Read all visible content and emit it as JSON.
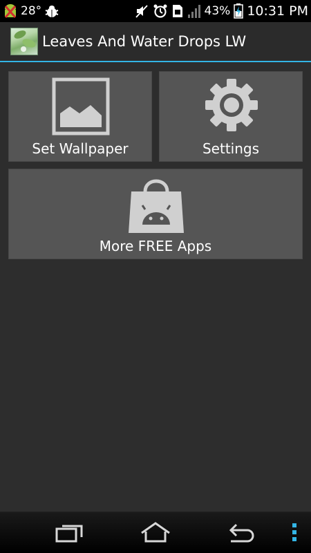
{
  "status_bar": {
    "temperature": "28°",
    "battery_percent": "43%",
    "time": "10:31 PM",
    "icons": [
      "android-debug-icon",
      "bug-icon",
      "mute-icon",
      "alarm-icon",
      "sim-icon",
      "signal-icon",
      "battery-charging-icon"
    ]
  },
  "action_bar": {
    "title": "Leaves And Water Drops LW",
    "accent_color": "#33b5e5"
  },
  "tiles": {
    "set_wallpaper": {
      "label": "Set Wallpaper",
      "icon": "image-icon"
    },
    "settings": {
      "label": "Settings",
      "icon": "gear-icon"
    },
    "more_apps": {
      "label": "More FREE Apps",
      "icon": "android-market-bag-icon"
    }
  },
  "nav_bar": {
    "icons": [
      "recent-apps-icon",
      "home-icon",
      "back-icon",
      "menu-icon"
    ],
    "menu_color": "#33b5e5"
  }
}
